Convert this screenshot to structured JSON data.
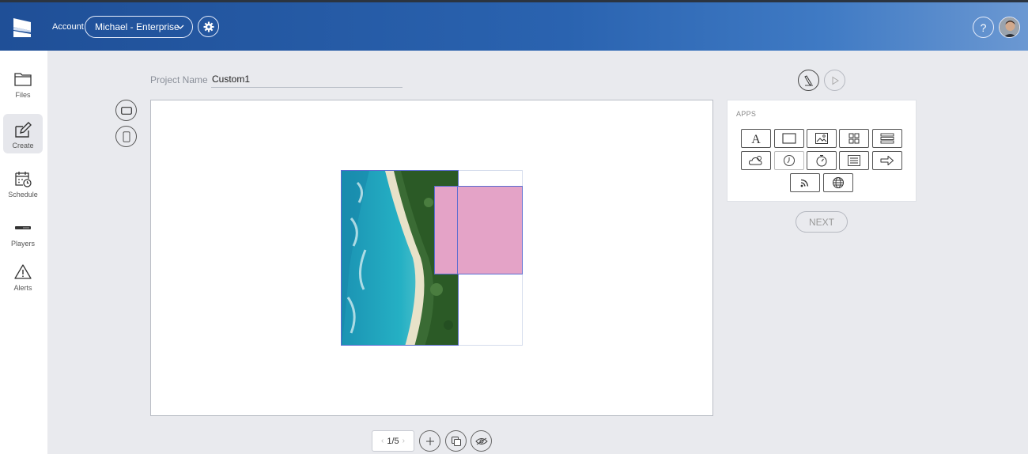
{
  "header": {
    "account_label": "Account",
    "account_value": "Michael - Enterprise",
    "help_label": "?"
  },
  "sidebar": {
    "items": [
      {
        "label": "Files",
        "icon": "folder-icon"
      },
      {
        "label": "Create",
        "icon": "edit-icon",
        "active": true
      },
      {
        "label": "Schedule",
        "icon": "calendar-clock-icon"
      },
      {
        "label": "Players",
        "icon": "player-device-icon"
      },
      {
        "label": "Alerts",
        "icon": "warning-icon"
      }
    ]
  },
  "project": {
    "label": "Project Name",
    "name": "Custom1"
  },
  "apps": {
    "title": "APPS",
    "items": [
      "text-icon",
      "rectangle-icon",
      "image-icon",
      "grid-icon",
      "list-layout-icon",
      "weather-icon",
      "clock-icon",
      "timer-icon",
      "document-list-icon",
      "arrow-right-icon",
      "rss-icon",
      "globe-icon"
    ]
  },
  "next_label": "NEXT",
  "pager": {
    "current": "1/5",
    "prev": "‹",
    "next": "›"
  },
  "colors": {
    "header": "#2a63b0",
    "pink_zone": "#e4a3c7",
    "zone_border": "#5b6cd1"
  }
}
